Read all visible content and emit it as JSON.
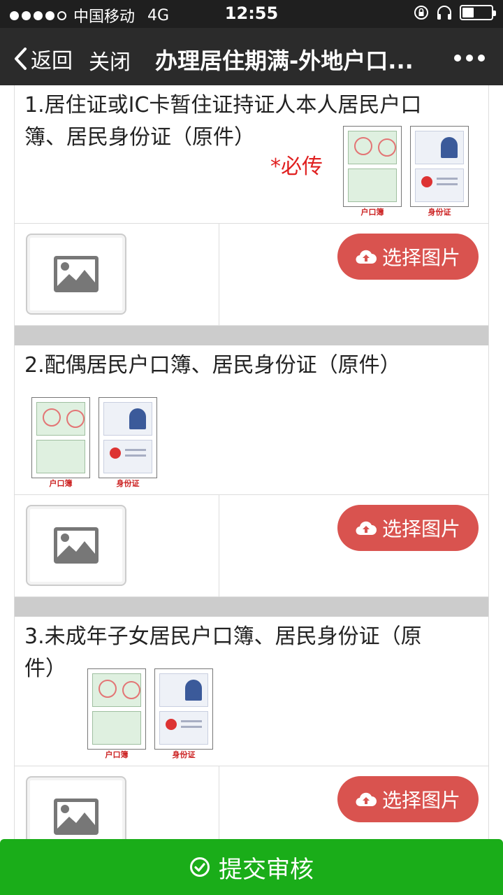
{
  "status_bar": {
    "carrier": "中国移动",
    "network": "4G",
    "time": "12:55"
  },
  "nav": {
    "back_label": "返回",
    "close_label": "关闭",
    "title": "办理居住期满-外地户口..."
  },
  "sections": [
    {
      "question": "1.居住证或IC卡暂住证持证人本人居民户口簿、居民身份证（原件）",
      "required": "*必传",
      "example_labels": [
        "户口簿",
        "身份证"
      ],
      "choose_label": "选择图片"
    },
    {
      "question": "2.配偶居民户口簿、居民身份证（原件）",
      "example_labels": [
        "户口簿",
        "身份证"
      ],
      "choose_label": "选择图片"
    },
    {
      "question": "3.未成年子女居民户口簿、居民身份证（原件）",
      "example_labels": [
        "户口簿",
        "身份证"
      ],
      "choose_label": "选择图片"
    }
  ],
  "submit_label": "提交审核",
  "colors": {
    "nav_bg": "#2b2b2b",
    "button_red": "#d9534f",
    "submit_green": "#1aad19",
    "required_red": "#e02020"
  }
}
